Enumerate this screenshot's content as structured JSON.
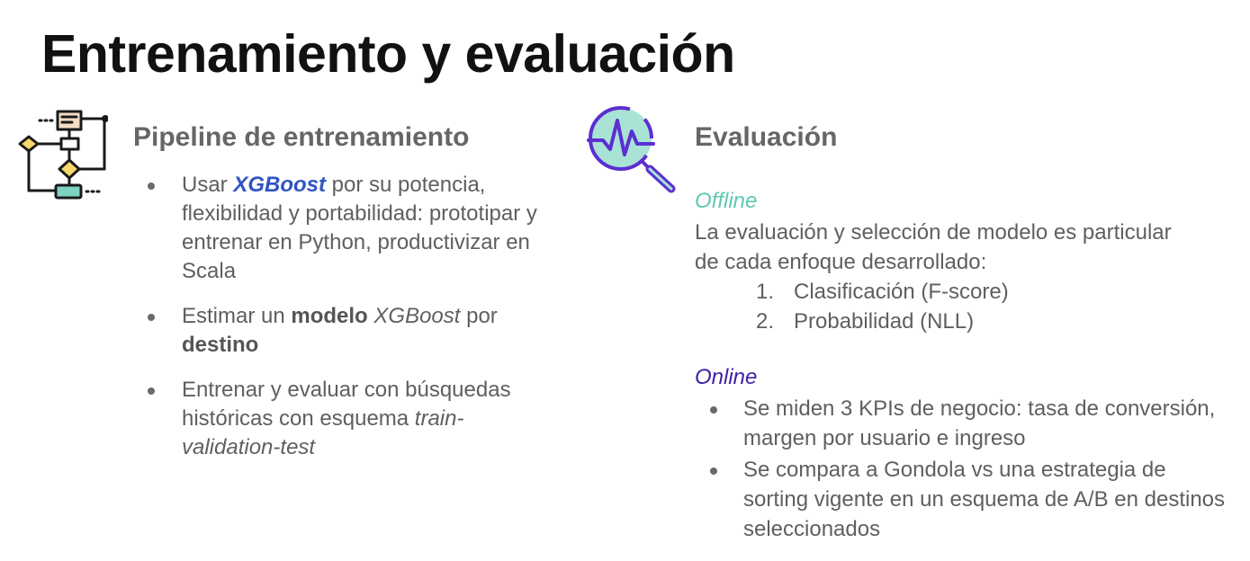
{
  "title": "Entrenamiento y evaluación",
  "icons": {
    "pipeline": "flowchart-icon",
    "evaluation": "magnifier-waveform-icon"
  },
  "colors": {
    "xgboost": "#2f55c2",
    "offline": "#5fc9b4",
    "online": "#3e1fa8",
    "heading": "#666666",
    "body": "#5f5f5f"
  },
  "pipeline": {
    "heading": "Pipeline de entrenamiento",
    "bullet1": {
      "pre": "Usar ",
      "brand": "XGBoost",
      "post": " por su potencia, flexibilidad y portabilidad: prototipar y entrenar en Python, productivizar en Scala"
    },
    "bullet2": {
      "pre": "Estimar un ",
      "bold1": "modelo",
      "mid": " ",
      "italic": "XGBoost",
      "post": " por ",
      "bold2": "destino"
    },
    "bullet3": {
      "pre": "Entrenar y evaluar con búsquedas históricas con esquema ",
      "italic": "train-validation-test"
    }
  },
  "evaluation": {
    "heading": "Evaluación",
    "offline": {
      "label": "Offline",
      "text": "La evaluación y selección de modelo es particular de cada enfoque desarrollado:",
      "items": [
        {
          "num": "1.",
          "text": "Clasificación (F-score)"
        },
        {
          "num": "2.",
          "text": "Probabilidad (NLL)"
        }
      ]
    },
    "online": {
      "label": "Online",
      "items": [
        "Se miden 3 KPIs de negocio: tasa de conversión, margen por usuario e ingreso",
        "Se compara a Gondola vs una estrategia de sorting vigente en un esquema de A/B en destinos seleccionados"
      ]
    }
  }
}
